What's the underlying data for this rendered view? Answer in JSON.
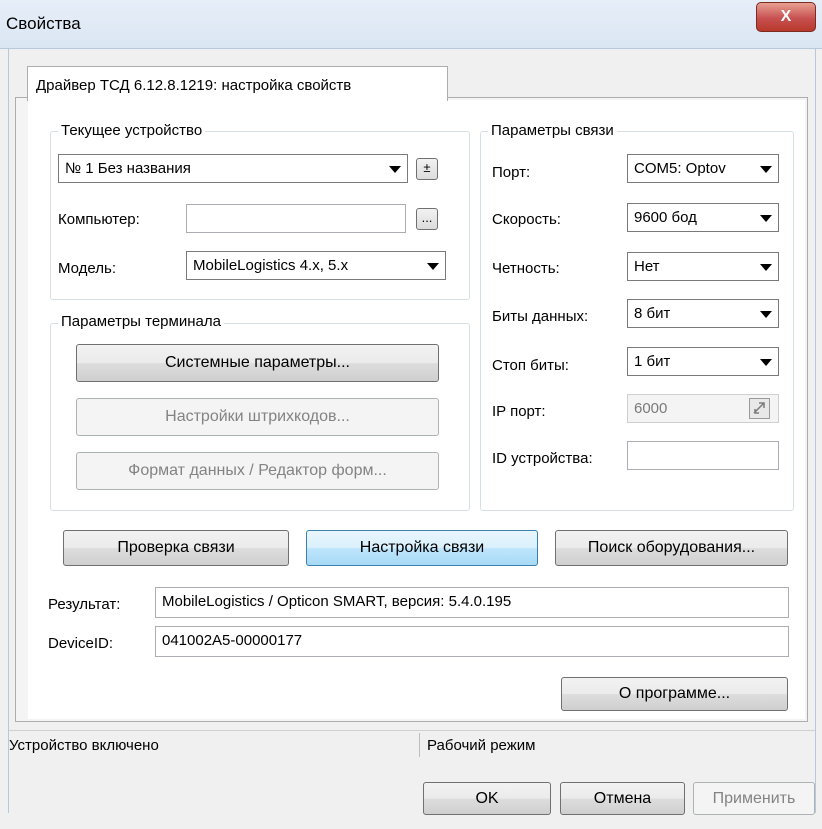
{
  "window": {
    "title": "Свойства",
    "close_glyph": "X"
  },
  "tab": {
    "label": "Драйвер ТСД 6.12.8.1219: настройка свойств"
  },
  "current_device": {
    "legend": "Текущее устройство",
    "device_select": "№ 1 Без названия",
    "add_remove_glyph": "±",
    "computer_label": "Компьютер:",
    "computer_value": "",
    "browse_glyph": "...",
    "model_label": "Модель:",
    "model_select": "MobileLogistics 4.x, 5.x"
  },
  "terminal_params": {
    "legend": "Параметры терминала",
    "system_params_button": "Системные параметры...",
    "barcode_settings_button": "Настройки штрихкодов...",
    "data_format_button": "Формат данных / Редактор форм..."
  },
  "connection_params": {
    "legend": "Параметры связи",
    "port_label": "Порт:",
    "port_value": "COM5: Optov",
    "speed_label": "Скорость:",
    "speed_value": "9600 бод",
    "parity_label": "Четность:",
    "parity_value": "Нет",
    "databits_label": "Биты данных:",
    "databits_value": "8 бит",
    "stopbits_label": "Стоп биты:",
    "stopbits_value": "1 бит",
    "ipport_label": "IP порт:",
    "ipport_value": "6000",
    "deviceid_label": "ID устройства:",
    "deviceid_value": ""
  },
  "actions": {
    "check_connection": "Проверка связи",
    "connection_setup": "Настройка связи",
    "find_equipment": "Поиск оборудования..."
  },
  "result": {
    "result_label": "Результат:",
    "result_value": "MobileLogistics / Opticon SMART, версия: 5.4.0.195",
    "deviceid_label": "DeviceID:",
    "deviceid_value": "041002A5-00000177"
  },
  "about_button": "О программе...",
  "status_bar": {
    "left": "Устройство включено",
    "right": "Рабочий режим"
  },
  "dialog_buttons": {
    "ok": "OK",
    "cancel": "Отмена",
    "apply": "Применить"
  }
}
